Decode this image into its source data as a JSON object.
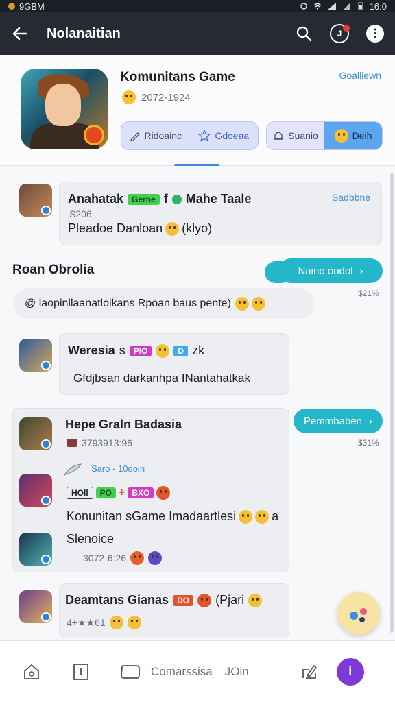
{
  "status_bar": {
    "left_text": "9GBM",
    "time": "16:0"
  },
  "app_bar": {
    "title": "Nolanaitian"
  },
  "header": {
    "game_name": "Komunitans Game",
    "game_meta": "2072-1924",
    "follow_link": "Goalliewn",
    "seg1": {
      "left_label": "Ridoainc",
      "right_label": "Gdoeaa"
    },
    "seg2": {
      "left_label": "Suanio",
      "right_label": "Deih"
    }
  },
  "posts": [
    {
      "title_a": "Anahatak",
      "tag": "Gerne",
      "title_b": "f",
      "title_c": "Mahe Taale",
      "sub": "S206",
      "body": "Pleadoe Danloan",
      "body_tail": "(klyo)",
      "link": "Sadbbne"
    }
  ],
  "section": {
    "title": "Roan Obrolia",
    "join_button": "Naino oodol",
    "join_price": "$21%",
    "message": "@ laopinllaanatlolkans Rpoan baus pente)"
  },
  "chat": [
    {
      "title": "Weresia",
      "title_suffix": "s",
      "tag": "PlO",
      "tag2": "D",
      "tail": "zk",
      "body": "Gfdjbsan darkanhpa INantahatkak"
    },
    {
      "title": "Hepe Graln Badasia",
      "meta": "3793913:96",
      "button": "Pemmbaben",
      "price": "$31%",
      "sub_meta": "Saro - 10doin",
      "tags": [
        "HOll",
        "PO",
        "BXO"
      ],
      "body": "Konunitan sGame Imadaartlesi",
      "body_tail": "a",
      "body2": "Slenoice",
      "meta2": "3072-6:26"
    },
    {
      "title": "Deamtans Gianas",
      "tail": "(Pjari",
      "meta": "4+★★61"
    }
  ],
  "bottom_nav": {
    "label1": "Comarssisa",
    "label2": "JOin"
  }
}
